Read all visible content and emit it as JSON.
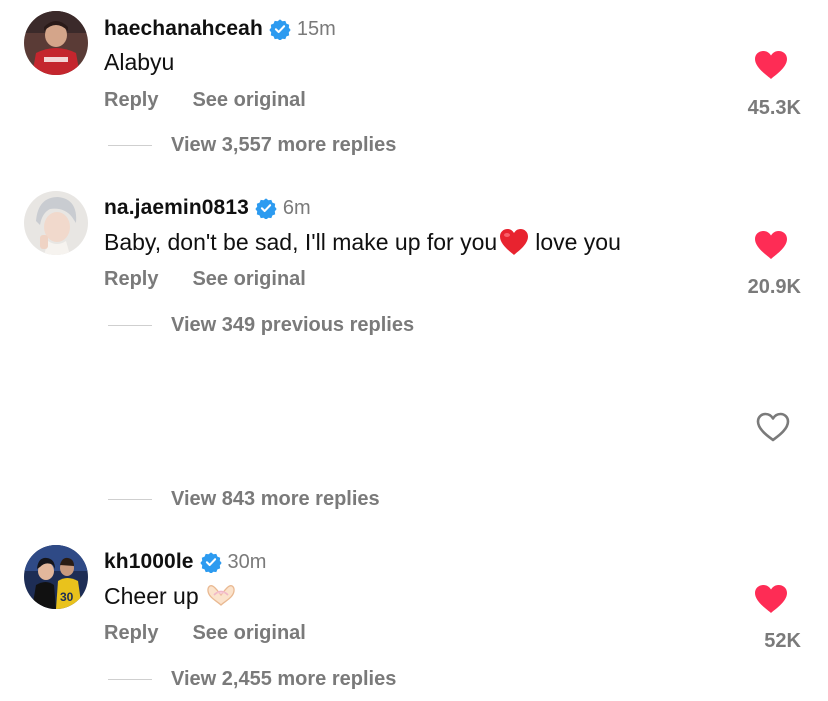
{
  "colors": {
    "like_red": "#fe2c55",
    "verified_blue": "#2d9bf0",
    "muted": "#7a7a7a"
  },
  "comments": [
    {
      "username": "haechanahceah",
      "verified": true,
      "time": "15m",
      "text": "Alabyu",
      "reply_label": "Reply",
      "see_original_label": "See original",
      "liked": true,
      "like_count": "45.3K",
      "view_replies": "View 3,557 more replies"
    },
    {
      "username": "na.jaemin0813",
      "verified": true,
      "time": "6m",
      "text_before_emoji": "Baby, don't be sad, I'll make up for you",
      "emoji": "red-heart-emoji",
      "text_after_emoji": "love you",
      "reply_label": "Reply",
      "see_original_label": "See original",
      "liked": true,
      "like_count": "20.9K",
      "view_replies": "View 349 previous replies"
    },
    {
      "liked": false,
      "view_replies": "View 843 more replies"
    },
    {
      "username": "kh1000le",
      "verified": true,
      "time": "30m",
      "text": "Cheer up",
      "emoji": "heart-hands-emoji",
      "reply_label": "Reply",
      "see_original_label": "See original",
      "liked": true,
      "like_count": "52K",
      "view_replies": "View 2,455 more replies"
    }
  ]
}
